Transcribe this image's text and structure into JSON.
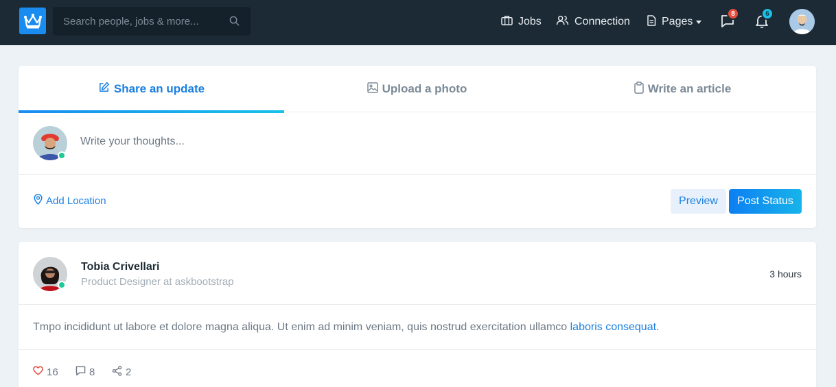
{
  "navbar": {
    "search_placeholder": "Search people, jobs & more...",
    "items": [
      {
        "label": "Jobs",
        "icon": "briefcase-icon"
      },
      {
        "label": "Connection",
        "icon": "users-icon"
      },
      {
        "label": "Pages",
        "icon": "file-icon"
      }
    ],
    "messages_count": "8",
    "notifications_count": "6",
    "colors": {
      "background": "#1c2a35",
      "logo": "#1a8cf0",
      "badge_messages": "#e74c3c",
      "badge_notifications": "#17c1e8"
    }
  },
  "share": {
    "tabs": [
      {
        "label": "Share an update",
        "icon": "edit-icon",
        "active": true
      },
      {
        "label": "Upload a photo",
        "icon": "image-icon",
        "active": false
      },
      {
        "label": "Write an article",
        "icon": "clipboard-icon",
        "active": false
      }
    ],
    "placeholder": "Write your thoughts...",
    "add_location": "Add Location",
    "preview_label": "Preview",
    "post_label": "Post Status"
  },
  "post": {
    "author": "Tobia Crivellari",
    "role": "Product Designer at askbootstrap",
    "time": "3 hours",
    "text": "Tmpo incididunt ut labore et dolore magna aliqua. Ut enim ad minim veniam, quis nostrud exercitation ullamco ",
    "link_text": "laboris consequat.",
    "likes": "16",
    "comments": "8",
    "shares": "2"
  },
  "accent_color": "#1a7fe0"
}
